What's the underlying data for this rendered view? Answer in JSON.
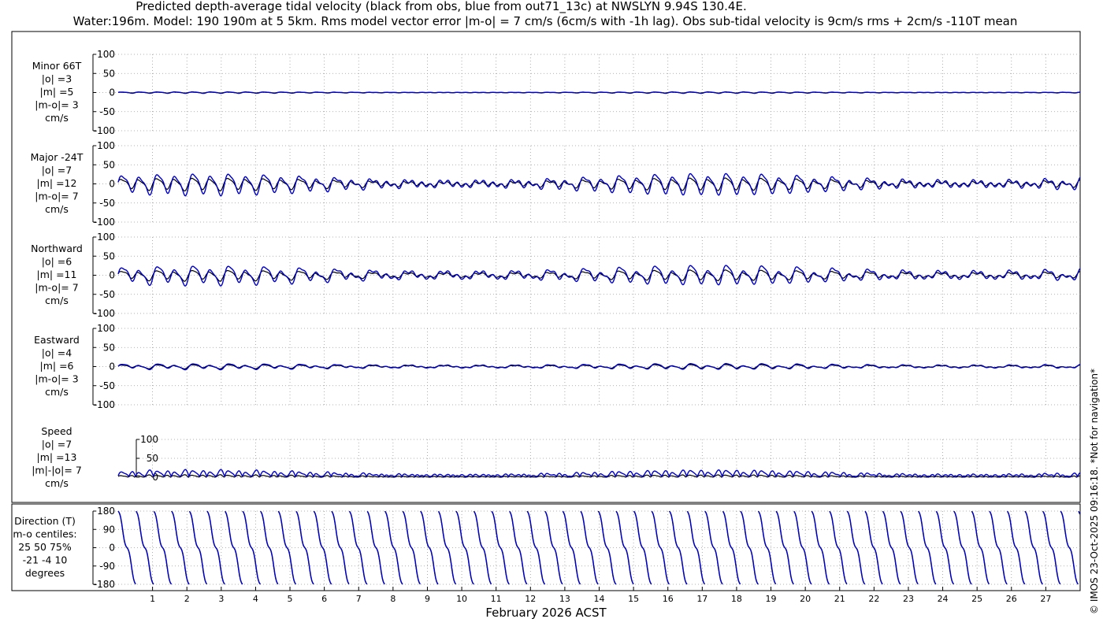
{
  "chart_data": {
    "type": "line",
    "title_line1": "Predicted depth-average tidal velocity (black from obs, blue from out71_13c) at NWSLYN 9.94S 130.4E.",
    "title_line2": "Water:196m. Model: 190 190m at 5 5km. Rms model vector error |m-o| = 7 cm/s (6cm/s with -1h lag). Obs sub-tidal velocity is 9cm/s rms + 2cm/s -110T mean",
    "xlabel": "February 2026 ACST",
    "x_range": [
      0,
      28
    ],
    "x_ticks": [
      "1",
      "2",
      "3",
      "4",
      "5",
      "6",
      "7",
      "8",
      "9",
      "10",
      "11",
      "12",
      "13",
      "14",
      "15",
      "16",
      "17",
      "18",
      "19",
      "20",
      "21",
      "22",
      "23",
      "24",
      "25",
      "26",
      "27"
    ],
    "grid": true,
    "side_note": "© IMOS 23-Oct-2025 09:16:18. *Not for navigation*",
    "colors": {
      "obs": "#000000",
      "model": "#0000cc",
      "grid": "#999999"
    },
    "series_legend": [
      "black from obs",
      "blue from out71_13c"
    ],
    "panels": [
      {
        "label": [
          "Minor 66T",
          "|o| =3",
          "|m| =5",
          "|m-o|= 3",
          "cm/s"
        ],
        "ylim": [
          -100,
          100
        ],
        "yticks": [
          "100",
          "50",
          "0",
          "-50",
          "-100"
        ],
        "obs_amp": 3,
        "model_amp": 5
      },
      {
        "label": [
          "Major -24T",
          "|o| =7",
          "|m| =12",
          "|m-o|= 7",
          "cm/s"
        ],
        "ylim": [
          -100,
          100
        ],
        "yticks": [
          "100",
          "50",
          "0",
          "-50",
          "-100"
        ],
        "obs_amp": 7,
        "model_amp": 12
      },
      {
        "label": [
          "Northward",
          "|o| =6",
          "|m| =11",
          "|m-o|= 7",
          "cm/s"
        ],
        "ylim": [
          -100,
          100
        ],
        "yticks": [
          "100",
          "50",
          "0",
          "-50",
          "-100"
        ],
        "obs_amp": 6,
        "model_amp": 11
      },
      {
        "label": [
          "Eastward",
          "|o| =4",
          "|m| =6",
          "|m-o|= 3",
          "cm/s"
        ],
        "ylim": [
          -100,
          100
        ],
        "yticks": [
          "100",
          "50",
          "0",
          "-50",
          "-100"
        ],
        "obs_amp": 4,
        "model_amp": 6
      },
      {
        "label": [
          "Speed",
          "|o| =7",
          "|m| =13",
          "|m|-|o|= 7",
          "cm/s"
        ],
        "ylim": [
          0,
          100
        ],
        "yticks": [
          "100",
          "50",
          "0"
        ],
        "obs_amp": 7,
        "model_amp": 13
      },
      {
        "label": [
          "Direction (T)",
          "m-o centiles:",
          "25  50  75%",
          "-21  -4  10",
          "degrees"
        ],
        "ylim": [
          -180,
          180
        ],
        "yticks": [
          "180",
          "90",
          "0",
          "-90",
          "-180"
        ]
      }
    ]
  }
}
